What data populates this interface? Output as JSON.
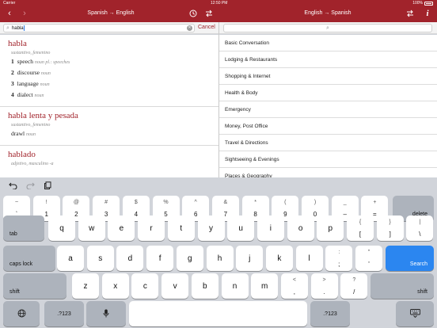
{
  "status": {
    "carrier": "Carrier",
    "time": "12:50 PM",
    "battery": "100%"
  },
  "left_header": {
    "title": "Spanish → English",
    "back": "‹",
    "forward": "›",
    "history_icon": "clock-icon",
    "swap_icon": "swap-icon"
  },
  "right_header": {
    "title": "English → Spanish",
    "swap_icon": "swap-icon",
    "info": "i"
  },
  "search": {
    "value": "habla",
    "placeholder": "",
    "cancel_label": "Cancel"
  },
  "entries": [
    {
      "headword": "habla",
      "gram": "sustantivo, femenino",
      "senses": [
        {
          "num": "1",
          "text": "speech",
          "gram": "noun pl.: speeches"
        },
        {
          "num": "2",
          "text": "discourse",
          "gram": "noun"
        },
        {
          "num": "3",
          "text": "language",
          "gram": "noun"
        },
        {
          "num": "4",
          "text": "dialect",
          "gram": "noun"
        }
      ]
    },
    {
      "headword": "habla lenta y pesada",
      "gram": "sustantivo, femenino",
      "senses": [
        {
          "num": "",
          "text": "drawl",
          "gram": "noun"
        }
      ]
    },
    {
      "headword": "hablado",
      "gram": "adjetivo, masculino -a",
      "senses": []
    }
  ],
  "categories": [
    "Basic Conversation",
    "Lodging & Restaurants",
    "Shopping & Internet",
    "Health & Body",
    "Emergency",
    "Money, Post Office",
    "Travel & Directions",
    "Sightseeing & Evenings",
    "Places & Geography"
  ],
  "keyboard": {
    "number_row": [
      {
        "top": "~",
        "bot": "`"
      },
      {
        "top": "!",
        "bot": "1"
      },
      {
        "top": "@",
        "bot": "2"
      },
      {
        "top": "#",
        "bot": "3"
      },
      {
        "top": "$",
        "bot": "4"
      },
      {
        "top": "%",
        "bot": "5"
      },
      {
        "top": "^",
        "bot": "6"
      },
      {
        "top": "&",
        "bot": "7"
      },
      {
        "top": "*",
        "bot": "8"
      },
      {
        "top": "(",
        "bot": "9"
      },
      {
        "top": ")",
        "bot": "0"
      },
      {
        "top": "_",
        "bot": "–"
      },
      {
        "top": "+",
        "bot": "="
      }
    ],
    "delete": "delete",
    "tab": "tab",
    "row_q": [
      "q",
      "w",
      "e",
      "r",
      "t",
      "y",
      "u",
      "i",
      "o",
      "p"
    ],
    "row_q_extra": [
      {
        "top": "{",
        "bot": "["
      },
      {
        "top": "}",
        "bot": "]"
      },
      {
        "top": "|",
        "bot": "\\"
      }
    ],
    "caps": "caps lock",
    "row_a": [
      "a",
      "s",
      "d",
      "f",
      "g",
      "h",
      "j",
      "k",
      "l"
    ],
    "row_a_extra": [
      {
        "top": ":",
        "bot": ";"
      },
      {
        "top": "\"",
        "bot": "'"
      }
    ],
    "search": "Search",
    "shift": "shift",
    "row_z": [
      "z",
      "x",
      "c",
      "v",
      "b",
      "n",
      "m"
    ],
    "row_z_extra": [
      {
        "top": "<",
        "bot": ","
      },
      {
        "top": ">",
        "bot": "."
      },
      {
        "top": "?",
        "bot": "/"
      }
    ],
    "num_switch": ".?123",
    "undo_icon": "undo-icon",
    "redo_icon": "redo-icon",
    "paste_icon": "clipboard-icon",
    "globe_icon": "globe-icon",
    "mic_icon": "microphone-icon",
    "hide_icon": "keyboard-hide-icon"
  }
}
